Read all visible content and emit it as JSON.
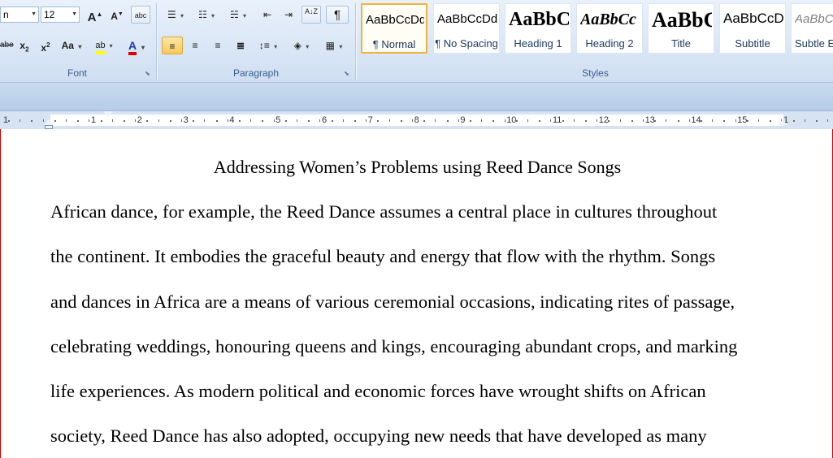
{
  "ribbon": {
    "font": {
      "label": "Font",
      "name_value": "n",
      "size_value": "12",
      "grow_label": "A",
      "shrink_label": "A",
      "clear_label": "abc",
      "strike_label": "abe",
      "sub_label": "x",
      "sub_mark": "2",
      "sup_label": "x",
      "sup_mark": "2",
      "case_label": "Aa",
      "highlight_label": "ab",
      "fontcolor_label": "A",
      "highlight_color": "#ffff00",
      "fontcolor_color": "#e00000"
    },
    "paragraph": {
      "label": "Paragraph",
      "pilcrow_label": "¶",
      "sort_label": "A↓Z"
    },
    "styles": {
      "label": "Styles",
      "items": [
        {
          "sample": "AaBbCcDd",
          "name": "¶ Normal"
        },
        {
          "sample": "AaBbCcDd",
          "name": "¶ No Spacing"
        },
        {
          "sample": "AaBbC",
          "name": "Heading 1"
        },
        {
          "sample": "AaBbCc",
          "name": "Heading 2"
        },
        {
          "sample": "AaBbC",
          "name": "Title"
        },
        {
          "sample": "AaBbCcD",
          "name": "Subtitle"
        },
        {
          "sample": "AaBbCcD",
          "name": "Subtle E"
        }
      ]
    }
  },
  "ruler": {
    "numbers": [
      "1",
      "1",
      "2",
      "3",
      "4",
      "5",
      "6",
      "7",
      "8",
      "9",
      "10",
      "11",
      "12",
      "13",
      "14",
      "15",
      "1"
    ]
  },
  "document": {
    "title": "Addressing Women’s Problems using Reed Dance Songs",
    "lines": [
      "African dance, for example, the Reed Dance assumes a central place in cultures throughout",
      "the continent. It embodies the graceful beauty and energy that flow with the rhythm. Songs",
      "and dances in Africa are a means of various ceremonial occasions, indicating rites of passage,",
      "celebrating weddings, honouring queens and kings, encouraging abundant crops, and marking",
      "life experiences. As modern political and economic forces have wrought shifts on African",
      "society, Reed Dance has also adopted, occupying new needs that have developed as many"
    ]
  }
}
